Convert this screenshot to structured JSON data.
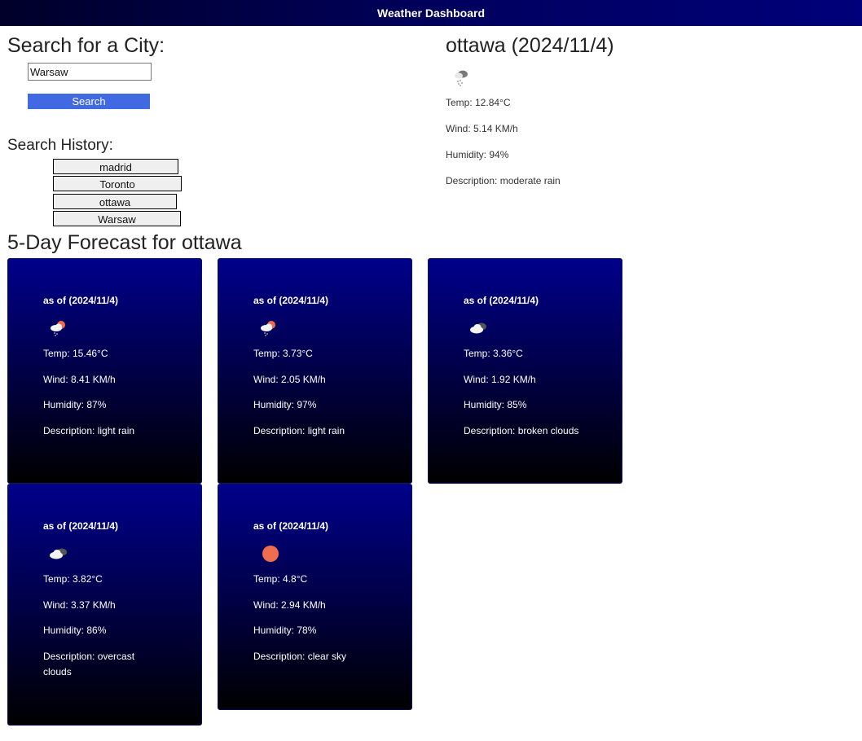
{
  "header": {
    "title": "Weather Dashboard"
  },
  "search": {
    "title": "Search for a City:",
    "input_value": "Warsaw",
    "button_label": "Search"
  },
  "history": {
    "title": "Search History:",
    "items": [
      {
        "label": "madrid"
      },
      {
        "label": "Toronto"
      },
      {
        "label": "ottawa"
      },
      {
        "label": "Warsaw"
      }
    ]
  },
  "current": {
    "title": "ottawa (2024/11/4)",
    "icon": "rain-cloud-icon",
    "temp": "Temp: 12.84°C",
    "wind": "Wind: 5.14 KM/h",
    "humidity": "Humidity: 94%",
    "description": "Description: moderate rain"
  },
  "forecast": {
    "title": "5-Day Forecast for ottawa",
    "cards": [
      {
        "date": "as of (2024/11/4)",
        "icon": "sun-rain-cloud-icon",
        "temp": "Temp: 15.46°C",
        "wind": "Wind: 8.41 KM/h",
        "humidity": "Humidity: 87%",
        "description": "Description: light rain"
      },
      {
        "date": "as of (2024/11/4)",
        "icon": "sun-rain-cloud-icon",
        "temp": "Temp: 3.73°C",
        "wind": "Wind: 2.05 KM/h",
        "humidity": "Humidity: 97%",
        "description": "Description: light rain"
      },
      {
        "date": "as of (2024/11/4)",
        "icon": "broken-clouds-icon",
        "temp": "Temp: 3.36°C",
        "wind": "Wind: 1.92 KM/h",
        "humidity": "Humidity: 85%",
        "description": "Description: broken clouds"
      },
      {
        "date": "as of (2024/11/4)",
        "icon": "overcast-clouds-icon",
        "temp": "Temp: 3.82°C",
        "wind": "Wind: 3.37 KM/h",
        "humidity": "Humidity: 86%",
        "description": "Description: overcast clouds"
      },
      {
        "date": "as of (2024/11/4)",
        "icon": "sun-icon",
        "temp": "Temp: 4.8°C",
        "wind": "Wind: 2.94 KM/h",
        "humidity": "Humidity: 78%",
        "description": "Description: clear sky"
      }
    ]
  },
  "colors": {
    "accent_button": "#4169e1",
    "card_top": "#00008b",
    "card_bottom": "#000000",
    "sun": "#f06c4e"
  }
}
